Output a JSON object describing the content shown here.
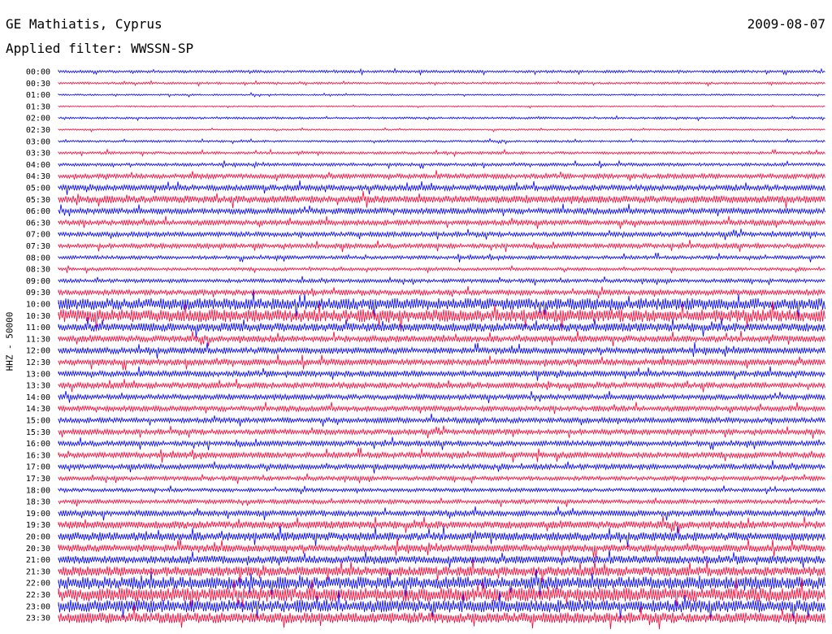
{
  "header": {
    "station": "GE Mathiatis, Cyprus",
    "date": "2009-08-07",
    "filter": "Applied filter: WWSSN-SP"
  },
  "chart_data": {
    "type": "line",
    "title": "GE Mathiatis, Cyprus",
    "subtitle": "Applied filter: WWSSN-SP",
    "ylabel": "HHZ - 50000",
    "colors": [
      "#0000ff",
      "#ff0033"
    ],
    "rows": [
      {
        "label": "00:00",
        "amp": 0.25
      },
      {
        "label": "00:30",
        "amp": 0.2
      },
      {
        "label": "01:00",
        "amp": 0.15
      },
      {
        "label": "01:30",
        "amp": 0.12
      },
      {
        "label": "02:00",
        "amp": 0.2
      },
      {
        "label": "02:30",
        "amp": 0.15
      },
      {
        "label": "03:00",
        "amp": 0.2
      },
      {
        "label": "03:30",
        "amp": 0.25
      },
      {
        "label": "04:00",
        "amp": 0.3
      },
      {
        "label": "04:30",
        "amp": 0.45
      },
      {
        "label": "05:00",
        "amp": 0.55
      },
      {
        "label": "05:30",
        "amp": 0.7
      },
      {
        "label": "06:00",
        "amp": 0.55
      },
      {
        "label": "06:30",
        "amp": 0.5
      },
      {
        "label": "07:00",
        "amp": 0.45
      },
      {
        "label": "07:30",
        "amp": 0.45
      },
      {
        "label": "08:00",
        "amp": 0.35
      },
      {
        "label": "08:30",
        "amp": 0.3
      },
      {
        "label": "09:00",
        "amp": 0.35
      },
      {
        "label": "09:30",
        "amp": 0.5
      },
      {
        "label": "10:00",
        "amp": 1.1
      },
      {
        "label": "10:30",
        "amp": 1.2
      },
      {
        "label": "11:00",
        "amp": 0.8
      },
      {
        "label": "11:30",
        "amp": 0.6
      },
      {
        "label": "12:00",
        "amp": 0.6
      },
      {
        "label": "12:30",
        "amp": 0.6
      },
      {
        "label": "13:00",
        "amp": 0.55
      },
      {
        "label": "13:30",
        "amp": 0.55
      },
      {
        "label": "14:00",
        "amp": 0.5
      },
      {
        "label": "14:30",
        "amp": 0.5
      },
      {
        "label": "15:00",
        "amp": 0.5
      },
      {
        "label": "15:30",
        "amp": 0.5
      },
      {
        "label": "16:00",
        "amp": 0.5
      },
      {
        "label": "16:30",
        "amp": 0.55
      },
      {
        "label": "17:00",
        "amp": 0.5
      },
      {
        "label": "17:30",
        "amp": 0.4
      },
      {
        "label": "18:00",
        "amp": 0.35
      },
      {
        "label": "18:30",
        "amp": 0.4
      },
      {
        "label": "19:00",
        "amp": 0.55
      },
      {
        "label": "19:30",
        "amp": 0.7
      },
      {
        "label": "20:00",
        "amp": 0.8
      },
      {
        "label": "20:30",
        "amp": 0.7
      },
      {
        "label": "21:00",
        "amp": 0.75
      },
      {
        "label": "21:30",
        "amp": 0.9
      },
      {
        "label": "22:00",
        "amp": 1.2
      },
      {
        "label": "22:30",
        "amp": 1.3
      },
      {
        "label": "23:00",
        "amp": 1.2
      },
      {
        "label": "23:30",
        "amp": 1.0
      }
    ]
  }
}
